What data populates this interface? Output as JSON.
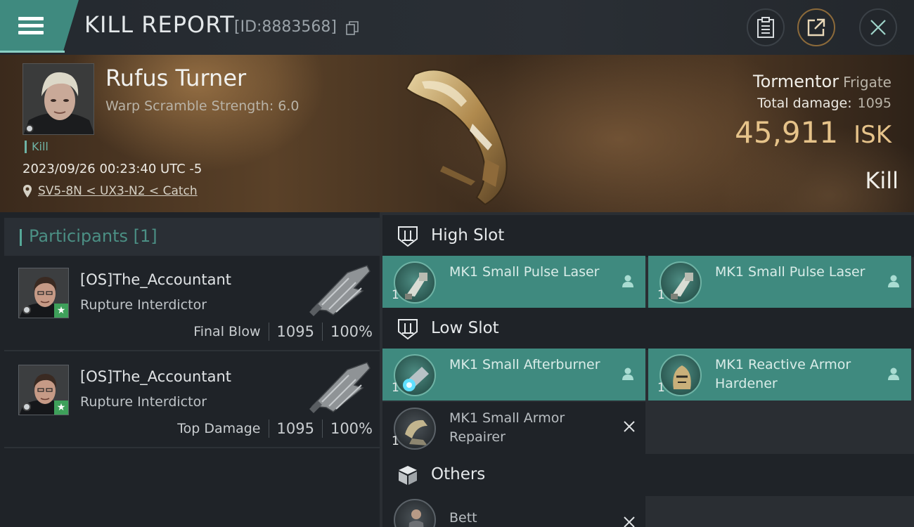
{
  "header": {
    "title": "KILL REPORT",
    "report_id": "[ID:8883568]"
  },
  "victim": {
    "name": "Rufus Turner",
    "warp_scramble": "Warp Scramble Strength: 6.0",
    "tag": "Kill",
    "datetime": "2023/09/26 00:23:40 UTC -5",
    "location": "SV5-8N < UX3-N2 < Catch",
    "ship_name": "Tormentor",
    "ship_class": "Frigate",
    "total_damage_label": "Total damage:",
    "total_damage": "1095",
    "isk_value": "45,911",
    "isk_unit": "ISK",
    "result": "Kill"
  },
  "participants": {
    "label": "Participants",
    "count": "[1]",
    "rows": [
      {
        "name": "[OS]The_Accountant",
        "ship": "Rupture Interdictor",
        "role": "Final Blow",
        "damage": "1095",
        "percent": "100%"
      },
      {
        "name": "[OS]The_Accountant",
        "ship": "Rupture Interdictor",
        "role": "Top Damage",
        "damage": "1095",
        "percent": "100%"
      }
    ]
  },
  "fitting": {
    "high_slot": {
      "label": "High Slot",
      "modules": [
        {
          "qty": "1",
          "name": "MK1 Small Pulse Laser",
          "status": "dropped"
        },
        {
          "qty": "1",
          "name": "MK1 Small Pulse Laser",
          "status": "dropped"
        }
      ]
    },
    "low_slot": {
      "label": "Low Slot",
      "modules": [
        {
          "qty": "1",
          "name": "MK1 Small Afterburner",
          "status": "dropped"
        },
        {
          "qty": "1",
          "name": "MK1 Reactive Armor Hardener",
          "status": "dropped"
        },
        {
          "qty": "1",
          "name": "MK1 Small Armor Repairer",
          "status": "destroyed"
        }
      ]
    },
    "others": {
      "label": "Others",
      "modules": [
        {
          "qty": "",
          "name": "Bett",
          "status": "destroyed"
        }
      ]
    }
  },
  "colors": {
    "accent": "#3f8a7f",
    "isk_gold": "#e6c38a",
    "background": "#1b1f24"
  }
}
